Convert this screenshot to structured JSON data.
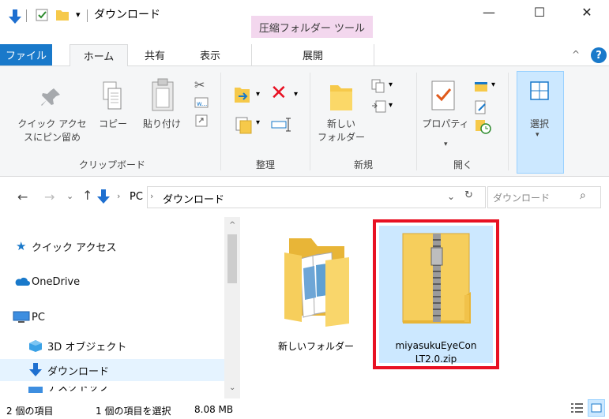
{
  "title_bar": {
    "context_tab": "圧縮フォルダー ツール",
    "minimize": "—",
    "maximize": "☐",
    "close": "✕"
  },
  "tabs": [
    {
      "label": "ファイル"
    },
    {
      "label": "ホーム"
    },
    {
      "label": "共有"
    },
    {
      "label": "表示"
    },
    {
      "label": "展開"
    }
  ],
  "ribbon": {
    "clipboard": {
      "pin_label_1": "クイック アクセ",
      "pin_label_2": "スにピン留め",
      "copy_label": "コピー",
      "paste_label": "貼り付け",
      "group_label": "クリップボード"
    },
    "organize": {
      "group_label": "整理"
    },
    "new": {
      "new_folder_1": "新しい",
      "new_folder_2": "フォルダー",
      "group_label": "新規"
    },
    "open": {
      "properties_label": "プロパティ",
      "group_label": "開く"
    },
    "select": {
      "select_label": "選択"
    }
  },
  "address": {
    "pc": "PC",
    "current": "ダウンロード",
    "search_placeholder": "ダウンロード"
  },
  "nav": [
    {
      "label": "クイック アクセス"
    },
    {
      "label": "OneDrive"
    },
    {
      "label": "PC"
    },
    {
      "label": "3D オブジェクト"
    },
    {
      "label": "ダウンロード"
    },
    {
      "label": "デスクトップ"
    }
  ],
  "files": [
    {
      "name": "新しいフォルダー"
    },
    {
      "name_line1": "miyasukuEyeCon",
      "name_line2": "LT2.0.zip"
    }
  ],
  "status": {
    "count": "2 個の項目",
    "selected": "1 個の項目を選択",
    "size": "8.08 MB"
  },
  "colors": {
    "accent": "#1979ca",
    "context_tab_bg": "#f3d7ee",
    "highlight_red": "#e81123",
    "selection": "#cce8ff"
  }
}
